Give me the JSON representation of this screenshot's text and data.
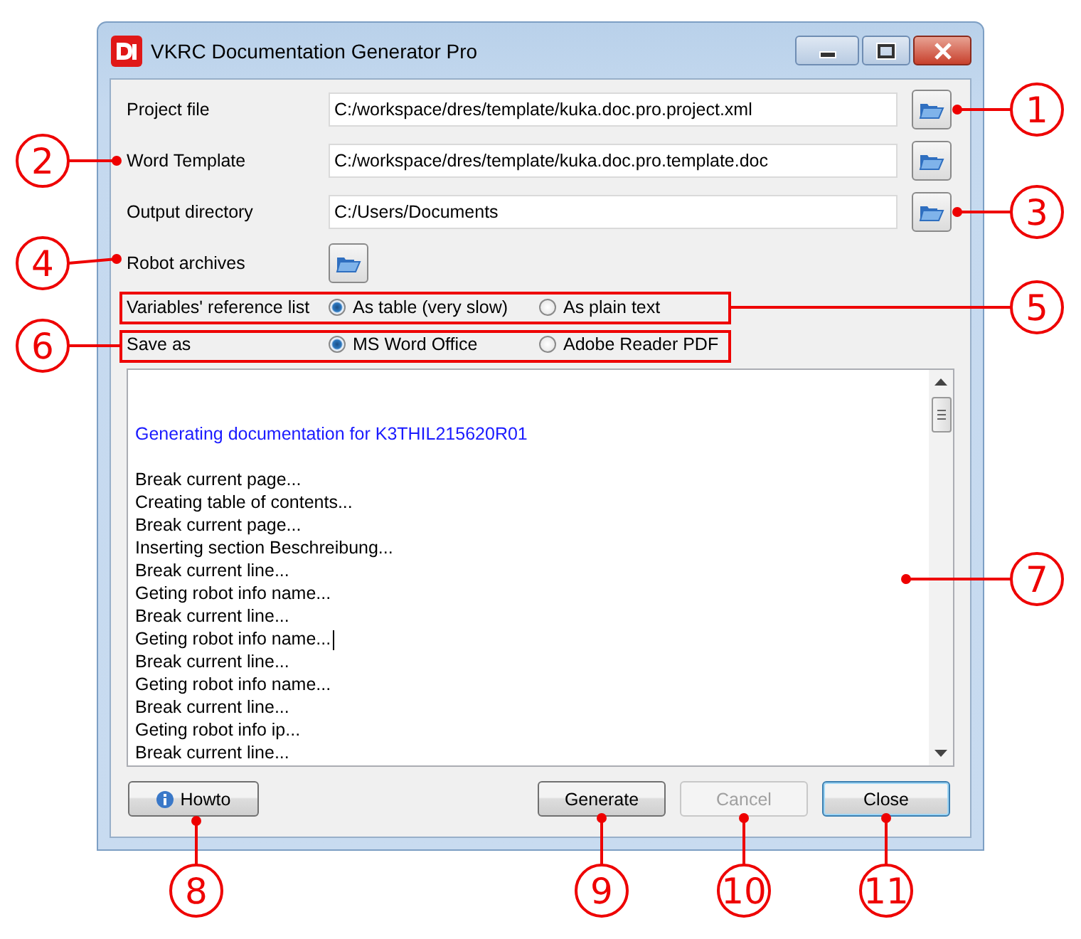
{
  "window": {
    "title": "VKRC Documentation Generator Pro"
  },
  "fields": [
    {
      "label": "Project file",
      "value": "C:/workspace/dres/template/kuka.doc.pro.project.xml",
      "kind": "path"
    },
    {
      "label": "Word Template",
      "value": "C:/workspace/dres/template/kuka.doc.pro.template.doc",
      "kind": "path"
    },
    {
      "label": "Output directory",
      "value": "C:/Users/Documents",
      "kind": "path"
    },
    {
      "label": "Robot archives",
      "kind": "browse"
    }
  ],
  "option_groups": [
    {
      "label": "Variables' reference list",
      "options": [
        {
          "label": "As table (very slow)",
          "selected": true
        },
        {
          "label": "As plain text",
          "selected": false
        }
      ]
    },
    {
      "label": "Save as",
      "options": [
        {
          "label": "MS Word Office",
          "selected": true
        },
        {
          "label": "Adobe Reader PDF",
          "selected": false
        }
      ]
    }
  ],
  "log": [
    {
      "text": "Generating documentation for K3THIL215620R01",
      "kind": "heading",
      "caret": false
    },
    {
      "text": "Break current page...",
      "kind": "text",
      "caret": false
    },
    {
      "text": "Creating table of contents...",
      "kind": "text",
      "caret": false
    },
    {
      "text": "Break current page...",
      "kind": "text",
      "caret": false
    },
    {
      "text": "Inserting section Beschreibung...",
      "kind": "text",
      "caret": false
    },
    {
      "text": "Break current line...",
      "kind": "text",
      "caret": false
    },
    {
      "text": "Geting robot info name...",
      "kind": "text",
      "caret": false
    },
    {
      "text": "Break current line...",
      "kind": "text",
      "caret": false
    },
    {
      "text": "Geting robot info name...",
      "kind": "text",
      "caret": true
    },
    {
      "text": "Break current line...",
      "kind": "text",
      "caret": false
    },
    {
      "text": "Geting robot info name...",
      "kind": "text",
      "caret": false
    },
    {
      "text": "Break current line...",
      "kind": "text",
      "caret": false
    },
    {
      "text": "Geting robot info ip...",
      "kind": "text",
      "caret": false
    },
    {
      "text": "Break current line...",
      "kind": "text",
      "caret": false
    }
  ],
  "buttons": [
    {
      "label": "Howto",
      "kind": "info",
      "disabled": false,
      "default": false
    },
    {
      "label": "Generate",
      "kind": "plain",
      "disabled": false,
      "default": false
    },
    {
      "label": "Cancel",
      "kind": "plain",
      "disabled": true,
      "default": false
    },
    {
      "label": "Close",
      "kind": "plain",
      "disabled": false,
      "default": true
    }
  ],
  "callouts": [
    {
      "number": "1"
    },
    {
      "number": "2"
    },
    {
      "number": "3"
    },
    {
      "number": "4"
    },
    {
      "number": "5"
    },
    {
      "number": "6"
    },
    {
      "number": "7"
    },
    {
      "number": "8"
    },
    {
      "number": "9"
    },
    {
      "number": "10"
    },
    {
      "number": "11"
    }
  ]
}
